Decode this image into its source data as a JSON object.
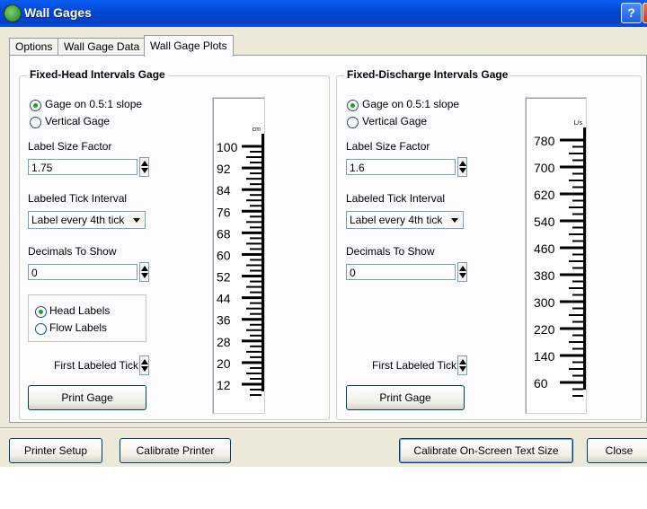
{
  "window": {
    "title": "Wall Gages",
    "help_label": "?"
  },
  "tabs": [
    {
      "label": "Options",
      "active": false
    },
    {
      "label": "Wall Gage Data",
      "active": false
    },
    {
      "label": "Wall Gage Plots",
      "active": true
    }
  ],
  "left": {
    "group_title": "Fixed-Head Intervals Gage",
    "radio_slope": "Gage on 0.5:1 slope",
    "radio_vertical": "Vertical Gage",
    "label_size_label": "Label Size Factor",
    "label_size_value": "1.75",
    "tick_interval_label": "Labeled Tick Interval",
    "tick_interval_value": "Label every 4th tick",
    "decimals_label": "Decimals To Show",
    "decimals_value": "0",
    "radio_head": "Head Labels",
    "radio_flow": "Flow Labels",
    "first_tick_label": "First Labeled Tick",
    "print_label": "Print Gage",
    "gage": {
      "unit": "cm",
      "labels": [
        "100",
        "92",
        "84",
        "76",
        "68",
        "60",
        "52",
        "44",
        "36",
        "28",
        "20",
        "12"
      ]
    }
  },
  "right": {
    "group_title": "Fixed-Discharge Intervals Gage",
    "radio_slope": "Gage on 0.5:1 slope",
    "radio_vertical": "Vertical Gage",
    "label_size_label": "Label Size Factor",
    "label_size_value": "1.6",
    "tick_interval_label": "Labeled Tick Interval",
    "tick_interval_value": "Label every 4th tick",
    "decimals_label": "Decimals To Show",
    "decimals_value": "0",
    "first_tick_label": "First Labeled Tick",
    "print_label": "Print Gage",
    "gage": {
      "unit": "L/s",
      "labels": [
        "780",
        "700",
        "620",
        "540",
        "460",
        "380",
        "300",
        "220",
        "140",
        "60"
      ]
    }
  },
  "bottom": {
    "printer_setup": "Printer Setup",
    "calibrate_printer": "Calibrate Printer",
    "calibrate_text": "Calibrate On-Screen Text Size",
    "close": "Close"
  },
  "colors": {
    "title_bar": "#0348d8",
    "face": "#ece9d8",
    "panel": "#fcfcfe",
    "radio_dot": "#21a121"
  }
}
